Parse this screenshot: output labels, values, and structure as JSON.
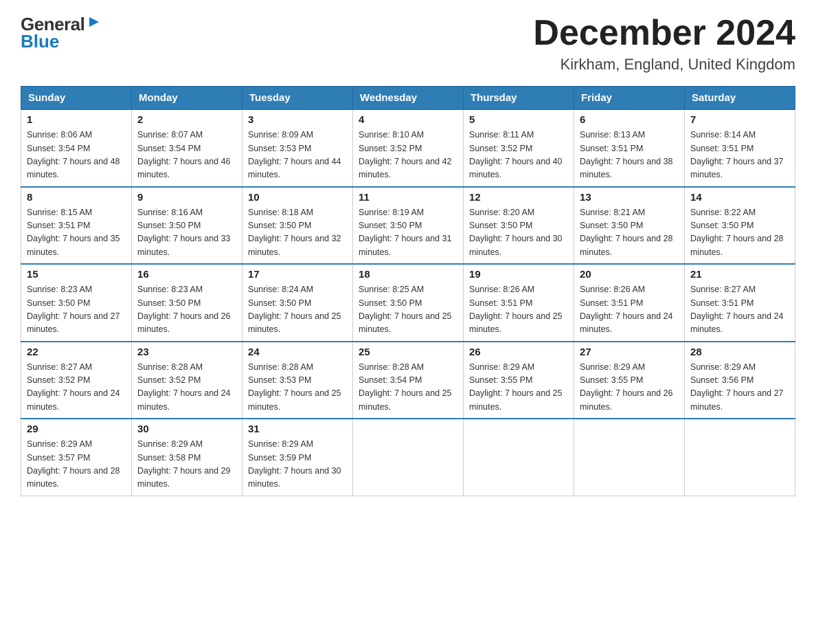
{
  "header": {
    "logo_general": "General",
    "logo_blue": "Blue",
    "month_title": "December 2024",
    "location": "Kirkham, England, United Kingdom"
  },
  "columns": [
    "Sunday",
    "Monday",
    "Tuesday",
    "Wednesday",
    "Thursday",
    "Friday",
    "Saturday"
  ],
  "weeks": [
    [
      {
        "day": "1",
        "sunrise": "8:06 AM",
        "sunset": "3:54 PM",
        "daylight": "7 hours and 48 minutes."
      },
      {
        "day": "2",
        "sunrise": "8:07 AM",
        "sunset": "3:54 PM",
        "daylight": "7 hours and 46 minutes."
      },
      {
        "day": "3",
        "sunrise": "8:09 AM",
        "sunset": "3:53 PM",
        "daylight": "7 hours and 44 minutes."
      },
      {
        "day": "4",
        "sunrise": "8:10 AM",
        "sunset": "3:52 PM",
        "daylight": "7 hours and 42 minutes."
      },
      {
        "day": "5",
        "sunrise": "8:11 AM",
        "sunset": "3:52 PM",
        "daylight": "7 hours and 40 minutes."
      },
      {
        "day": "6",
        "sunrise": "8:13 AM",
        "sunset": "3:51 PM",
        "daylight": "7 hours and 38 minutes."
      },
      {
        "day": "7",
        "sunrise": "8:14 AM",
        "sunset": "3:51 PM",
        "daylight": "7 hours and 37 minutes."
      }
    ],
    [
      {
        "day": "8",
        "sunrise": "8:15 AM",
        "sunset": "3:51 PM",
        "daylight": "7 hours and 35 minutes."
      },
      {
        "day": "9",
        "sunrise": "8:16 AM",
        "sunset": "3:50 PM",
        "daylight": "7 hours and 33 minutes."
      },
      {
        "day": "10",
        "sunrise": "8:18 AM",
        "sunset": "3:50 PM",
        "daylight": "7 hours and 32 minutes."
      },
      {
        "day": "11",
        "sunrise": "8:19 AM",
        "sunset": "3:50 PM",
        "daylight": "7 hours and 31 minutes."
      },
      {
        "day": "12",
        "sunrise": "8:20 AM",
        "sunset": "3:50 PM",
        "daylight": "7 hours and 30 minutes."
      },
      {
        "day": "13",
        "sunrise": "8:21 AM",
        "sunset": "3:50 PM",
        "daylight": "7 hours and 28 minutes."
      },
      {
        "day": "14",
        "sunrise": "8:22 AM",
        "sunset": "3:50 PM",
        "daylight": "7 hours and 28 minutes."
      }
    ],
    [
      {
        "day": "15",
        "sunrise": "8:23 AM",
        "sunset": "3:50 PM",
        "daylight": "7 hours and 27 minutes."
      },
      {
        "day": "16",
        "sunrise": "8:23 AM",
        "sunset": "3:50 PM",
        "daylight": "7 hours and 26 minutes."
      },
      {
        "day": "17",
        "sunrise": "8:24 AM",
        "sunset": "3:50 PM",
        "daylight": "7 hours and 25 minutes."
      },
      {
        "day": "18",
        "sunrise": "8:25 AM",
        "sunset": "3:50 PM",
        "daylight": "7 hours and 25 minutes."
      },
      {
        "day": "19",
        "sunrise": "8:26 AM",
        "sunset": "3:51 PM",
        "daylight": "7 hours and 25 minutes."
      },
      {
        "day": "20",
        "sunrise": "8:26 AM",
        "sunset": "3:51 PM",
        "daylight": "7 hours and 24 minutes."
      },
      {
        "day": "21",
        "sunrise": "8:27 AM",
        "sunset": "3:51 PM",
        "daylight": "7 hours and 24 minutes."
      }
    ],
    [
      {
        "day": "22",
        "sunrise": "8:27 AM",
        "sunset": "3:52 PM",
        "daylight": "7 hours and 24 minutes."
      },
      {
        "day": "23",
        "sunrise": "8:28 AM",
        "sunset": "3:52 PM",
        "daylight": "7 hours and 24 minutes."
      },
      {
        "day": "24",
        "sunrise": "8:28 AM",
        "sunset": "3:53 PM",
        "daylight": "7 hours and 25 minutes."
      },
      {
        "day": "25",
        "sunrise": "8:28 AM",
        "sunset": "3:54 PM",
        "daylight": "7 hours and 25 minutes."
      },
      {
        "day": "26",
        "sunrise": "8:29 AM",
        "sunset": "3:55 PM",
        "daylight": "7 hours and 25 minutes."
      },
      {
        "day": "27",
        "sunrise": "8:29 AM",
        "sunset": "3:55 PM",
        "daylight": "7 hours and 26 minutes."
      },
      {
        "day": "28",
        "sunrise": "8:29 AM",
        "sunset": "3:56 PM",
        "daylight": "7 hours and 27 minutes."
      }
    ],
    [
      {
        "day": "29",
        "sunrise": "8:29 AM",
        "sunset": "3:57 PM",
        "daylight": "7 hours and 28 minutes."
      },
      {
        "day": "30",
        "sunrise": "8:29 AM",
        "sunset": "3:58 PM",
        "daylight": "7 hours and 29 minutes."
      },
      {
        "day": "31",
        "sunrise": "8:29 AM",
        "sunset": "3:59 PM",
        "daylight": "7 hours and 30 minutes."
      },
      null,
      null,
      null,
      null
    ]
  ]
}
